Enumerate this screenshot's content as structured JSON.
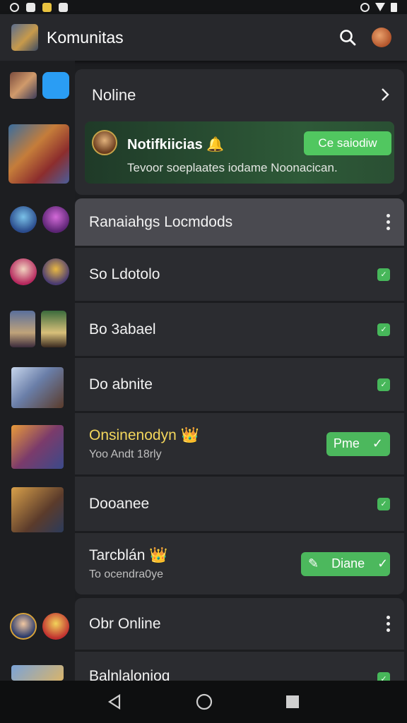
{
  "app": {
    "title": "Komunitas"
  },
  "header_card": {
    "label": "Noline"
  },
  "notification": {
    "title": "Notifkiicias 🔔",
    "body": "Tevoor soeplaates iodame Noonacican.",
    "button": "Ce saiodiw"
  },
  "rows": [
    {
      "label": "Ranaiahgs Locmdods",
      "trailing": "menu"
    },
    {
      "label": "So Ldotolo",
      "trailing": "check"
    },
    {
      "label": "Bo 3abael",
      "trailing": "check"
    },
    {
      "label": "Do abnite",
      "trailing": "check"
    },
    {
      "label": "Onsinenodyn 👑",
      "sub": "Yoo Andt 18rly",
      "trailing": "pill",
      "pill": "Pme"
    },
    {
      "label": "Dooanee",
      "trailing": "check"
    },
    {
      "label": "Tarcblán 👑",
      "sub": "To ocendra0ye",
      "trailing": "pill",
      "pill": "Diane"
    },
    {
      "label": "Obr Online",
      "trailing": "menu"
    },
    {
      "label": "Balnlalonioq",
      "trailing": "check"
    }
  ],
  "colors": {
    "accent_green": "#4cb85d",
    "gold_text": "#f3d65c",
    "bg": "#1c1d20",
    "card": "#2b2c30"
  }
}
